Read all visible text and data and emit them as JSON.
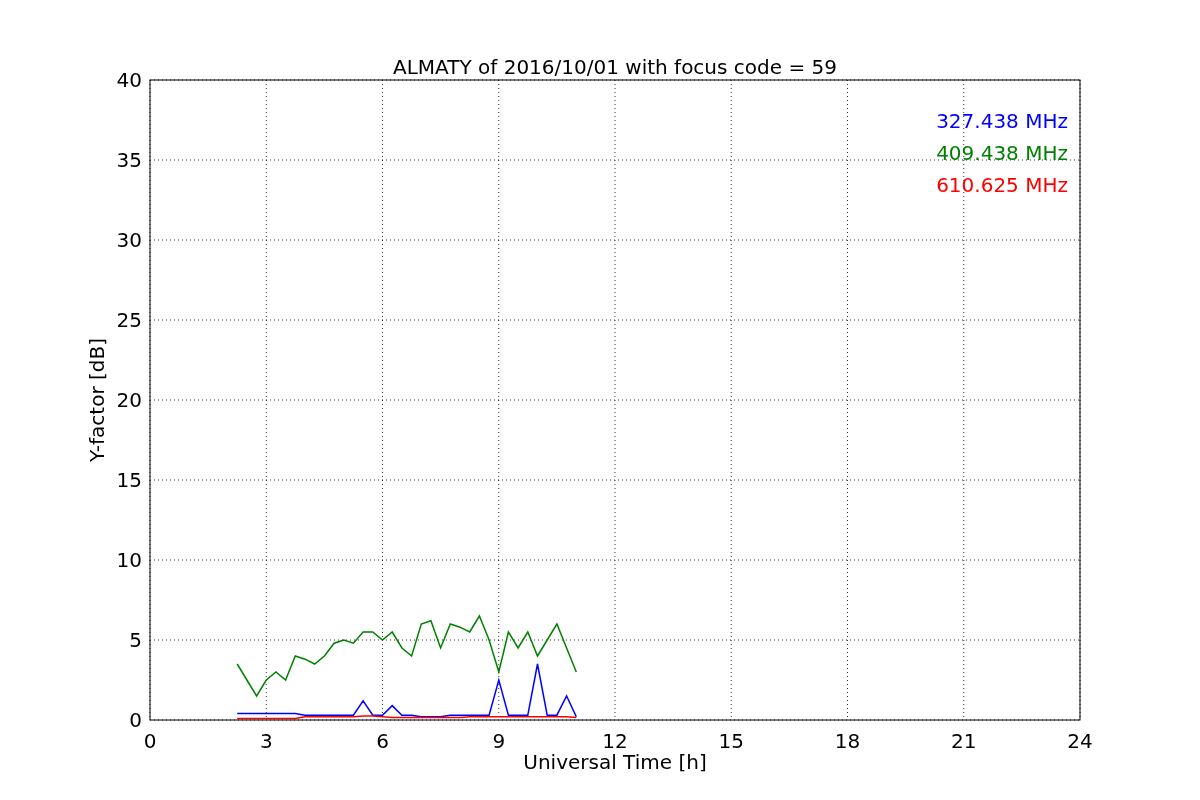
{
  "chart": {
    "chart_data": {
      "type": "line",
      "title": "ALMATY of 2016/10/01 with focus code = 59",
      "xlabel": "Universal Time [h]",
      "ylabel": "Y-factor [dB]",
      "x": [
        2.25,
        2.5,
        2.75,
        3.0,
        3.25,
        3.5,
        3.75,
        4.0,
        4.25,
        4.5,
        4.75,
        5.0,
        5.25,
        5.5,
        5.75,
        6.0,
        6.25,
        6.5,
        6.75,
        7.0,
        7.25,
        7.5,
        7.75,
        8.0,
        8.25,
        8.5,
        8.75,
        9.0,
        9.25,
        9.5,
        9.75,
        10.0,
        10.25,
        10.5,
        10.75,
        11.0
      ],
      "series": [
        {
          "name": "327.438 MHz",
          "color": "#0000ff",
          "values": [
            0.4,
            0.4,
            0.4,
            0.4,
            0.4,
            0.4,
            0.4,
            0.3,
            0.3,
            0.3,
            0.3,
            0.3,
            0.3,
            1.2,
            0.3,
            0.3,
            0.9,
            0.3,
            0.3,
            0.2,
            0.2,
            0.2,
            0.3,
            0.3,
            0.3,
            0.3,
            0.3,
            2.5,
            0.3,
            0.3,
            0.3,
            3.5,
            0.3,
            0.3,
            1.5,
            0.2
          ]
        },
        {
          "name": "409.438 MHz",
          "color": "#008000",
          "values": [
            3.5,
            2.5,
            1.5,
            2.5,
            3.0,
            2.5,
            4.0,
            3.8,
            3.5,
            4.0,
            4.8,
            5.0,
            4.8,
            5.5,
            5.5,
            5.0,
            5.5,
            4.5,
            4.0,
            6.0,
            6.2,
            4.5,
            6.0,
            5.8,
            5.5,
            6.5,
            5.0,
            3.0,
            5.5,
            4.5,
            5.5,
            4.0,
            5.0,
            6.0,
            4.5,
            3.0
          ]
        },
        {
          "name": "610.625 MHz",
          "color": "#ff0000",
          "values": [
            0.1,
            0.1,
            0.1,
            0.1,
            0.1,
            0.1,
            0.1,
            0.2,
            0.2,
            0.2,
            0.2,
            0.2,
            0.2,
            0.25,
            0.25,
            0.2,
            0.15,
            0.15,
            0.15,
            0.15,
            0.15,
            0.15,
            0.15,
            0.15,
            0.2,
            0.2,
            0.2,
            0.2,
            0.2,
            0.2,
            0.2,
            0.2,
            0.2,
            0.2,
            0.2,
            0.15
          ]
        }
      ],
      "grid": true,
      "xlim": [
        0,
        24
      ],
      "ylim": [
        0,
        40
      ],
      "xticks": [
        0,
        3,
        6,
        9,
        12,
        15,
        18,
        21,
        24
      ],
      "yticks": [
        0,
        5,
        10,
        15,
        20,
        25,
        30,
        35,
        40
      ]
    }
  }
}
